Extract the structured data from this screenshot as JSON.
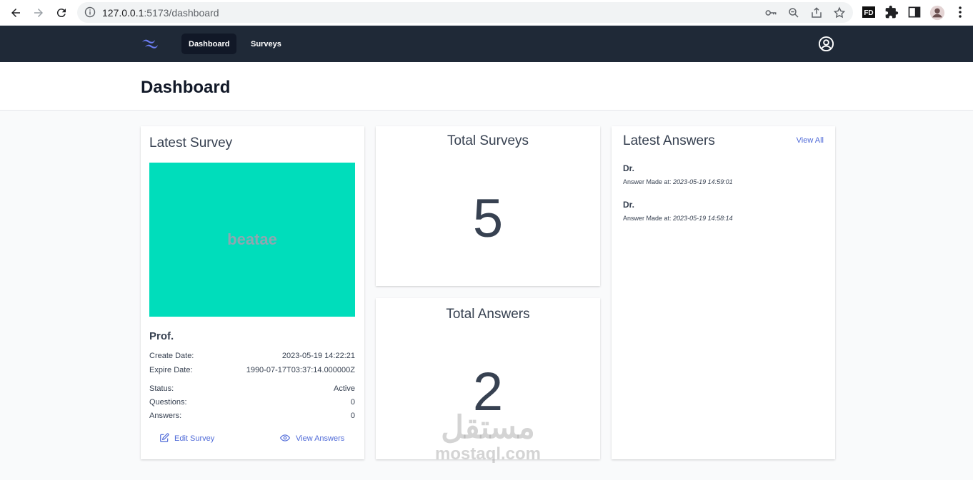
{
  "browser": {
    "url_host": "127.0.0.1",
    "url_path": ":5173/dashboard"
  },
  "nav": {
    "dashboard_label": "Dashboard",
    "surveys_label": "Surveys"
  },
  "page": {
    "title": "Dashboard"
  },
  "latest_survey": {
    "heading": "Latest Survey",
    "image_text": "beatae",
    "image_color": "#00ddbb",
    "name": "Prof.",
    "create_date_label": "Create Date:",
    "create_date": "2023-05-19 14:22:21",
    "expire_date_label": "Expire Date:",
    "expire_date": "1990-07-17T03:37:14.000000Z",
    "status_label": "Status:",
    "status": "Active",
    "questions_label": "Questions:",
    "questions": "0",
    "answers_label": "Answers:",
    "answers": "0",
    "edit_label": "Edit Survey",
    "view_label": "View Answers"
  },
  "total_surveys": {
    "heading": "Total Surveys",
    "value": "5"
  },
  "total_answers": {
    "heading": "Total Answers",
    "value": "2"
  },
  "latest_answers": {
    "heading": "Latest Answers",
    "view_all": "View All",
    "items": [
      {
        "title": "Dr.",
        "meta_label": "Answer Made at:",
        "time": "2023-05-19 14:59:01"
      },
      {
        "title": "Dr.",
        "meta_label": "Answer Made at:",
        "time": "2023-05-19 14:58:14"
      }
    ]
  },
  "watermark": {
    "arabic": "مستقل",
    "latin": "mostaql.com"
  },
  "colors": {
    "nav_bg": "#1f2937",
    "accent": "#4f6ad8",
    "logo": "#6366f1"
  }
}
